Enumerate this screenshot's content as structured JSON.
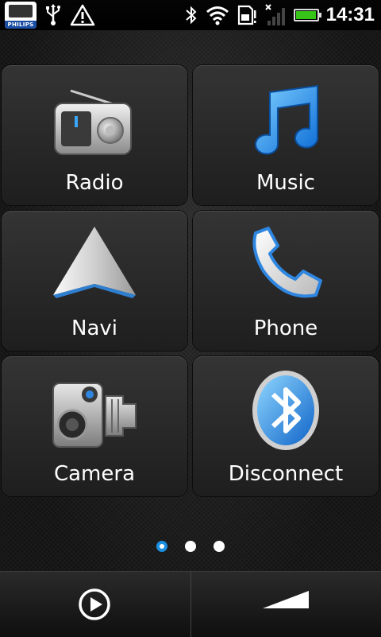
{
  "statusbar": {
    "brand_label": "PHILIPS",
    "time": "14:31",
    "battery_color": "#35c417",
    "battery_level": 0.95,
    "icons": [
      "usb-icon",
      "warning-icon",
      "bluetooth-icon",
      "wifi-icon",
      "sd-card-icon",
      "no-signal-icon",
      "battery-icon"
    ]
  },
  "tiles": [
    {
      "label": "Radio",
      "icon": "radio-icon"
    },
    {
      "label": "Music",
      "icon": "music-note-icon"
    },
    {
      "label": "Navi",
      "icon": "navigation-arrow-icon"
    },
    {
      "label": "Phone",
      "icon": "phone-handset-icon"
    },
    {
      "label": "Camera",
      "icon": "speed-camera-icon"
    },
    {
      "label": "Disconnect",
      "icon": "bluetooth-disconnect-icon"
    }
  ],
  "pager": {
    "pages": 3,
    "active": 0,
    "active_color": "#1b8fe0"
  },
  "bottombar": {
    "left_icon": "play-icon",
    "right_icon": "volume-ramp-icon"
  }
}
